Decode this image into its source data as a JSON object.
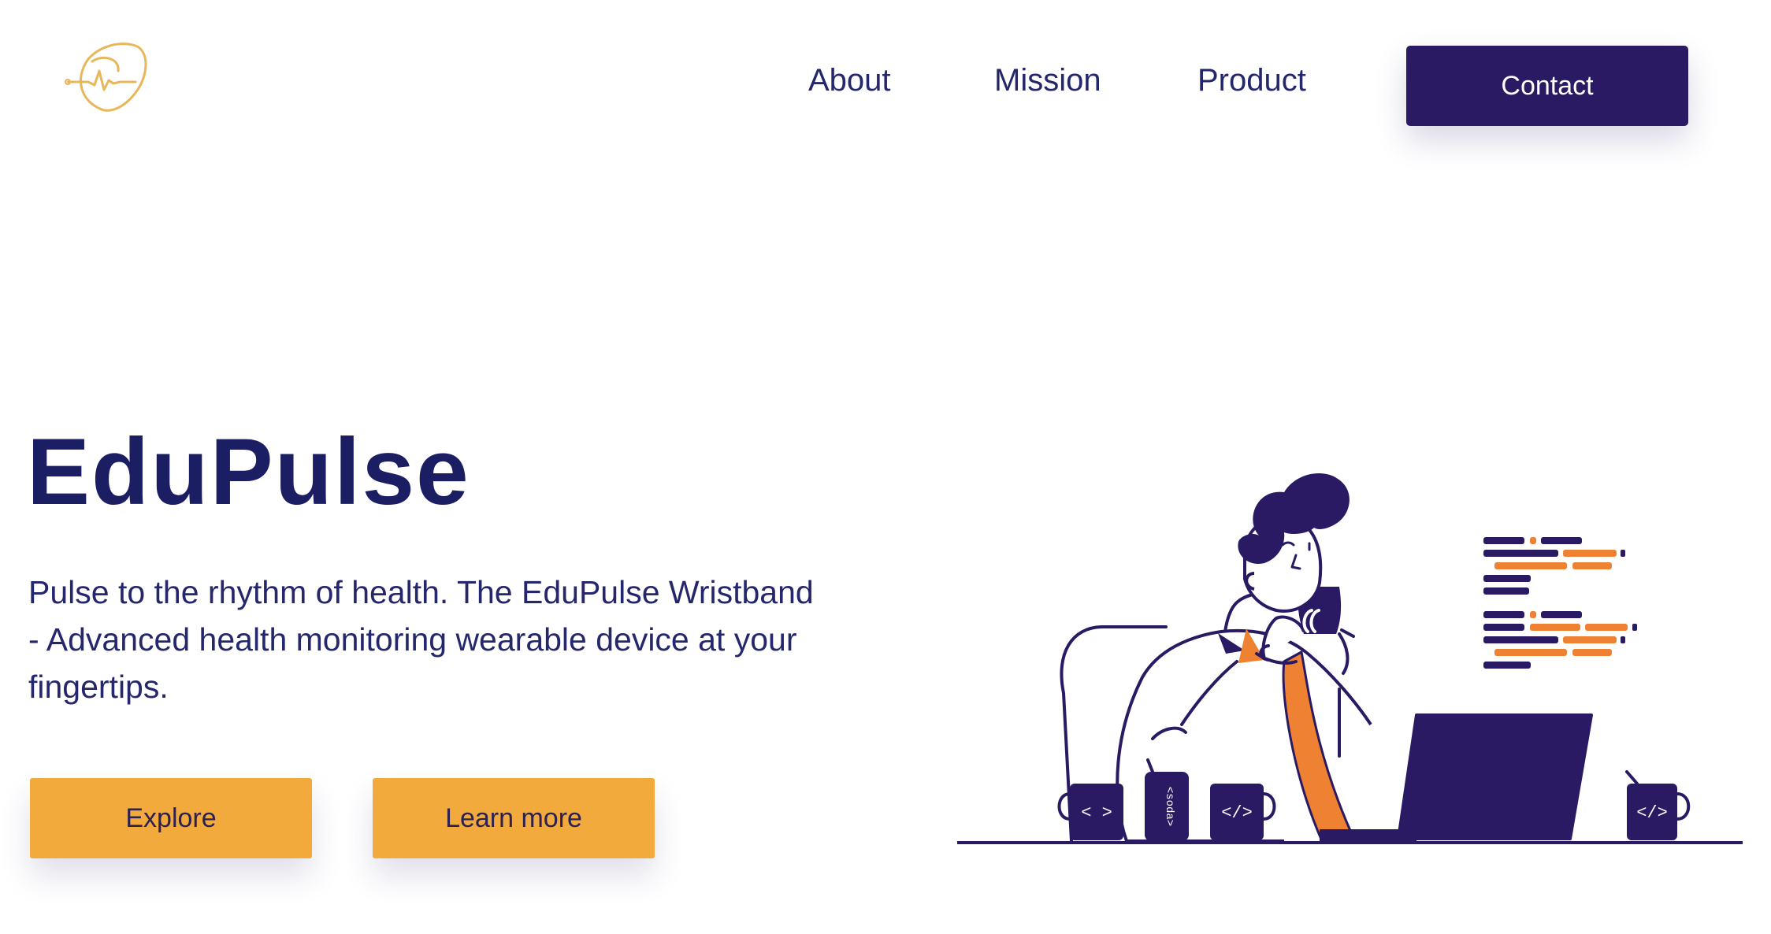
{
  "brand": {
    "logo_icon": "heart-pulse-icon",
    "logo_color": "#e7b75a"
  },
  "nav": {
    "items": [
      {
        "label": "About"
      },
      {
        "label": "Mission"
      },
      {
        "label": "Product"
      }
    ],
    "contact_label": "Contact"
  },
  "hero": {
    "title": "EduPulse",
    "description": "Pulse to the rhythm of health. The EduPulse Wristband - Advanced health monitoring wearable device at your fingertips.",
    "explore_label": "Explore",
    "learn_more_label": "Learn more"
  },
  "illustration": {
    "mug_left_label": "< >",
    "can_label": "<soda>",
    "mug_middle_label": "</>",
    "mug_right_label": "</>"
  },
  "colors": {
    "primary": "#2a1a63",
    "accent": "#f2aa3d",
    "orange": "#ef8132",
    "text": "#1c1e63"
  }
}
